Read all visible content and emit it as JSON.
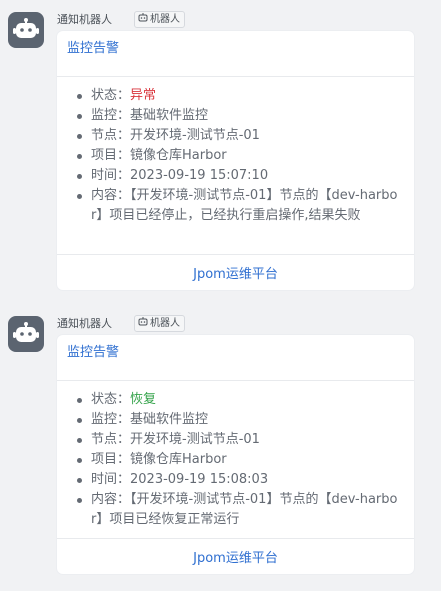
{
  "messages": [
    {
      "sender": "通知机器人",
      "bot_tag": "机器人",
      "card": {
        "title": "监控告警",
        "items": [
          {
            "label": "状态：",
            "value": "异常",
            "status_color": "#d9363e"
          },
          {
            "label": "监控：",
            "value": "基础软件监控"
          },
          {
            "label": "节点：",
            "value": "开发环境-测试节点-01"
          },
          {
            "label": "项目：",
            "value": "镜像仓库Harbor"
          },
          {
            "label": "时间：",
            "value": "2023-09-19 15:07:10"
          },
          {
            "label": "内容：",
            "value": "【开发环境-测试节点-01】节点的【dev-harbor】项目已经停止，已经执行重启操作,结果失败"
          }
        ],
        "footer_link": "Jpom运维平台"
      }
    },
    {
      "sender": "通知机器人",
      "bot_tag": "机器人",
      "card": {
        "title": "监控告警",
        "items": [
          {
            "label": "状态：",
            "value": "恢复",
            "status_color": "#34a34a"
          },
          {
            "label": "监控：",
            "value": "基础软件监控"
          },
          {
            "label": "节点：",
            "value": "开发环境-测试节点-01"
          },
          {
            "label": "项目：",
            "value": "镜像仓库Harbor"
          },
          {
            "label": "时间：",
            "value": "2023-09-19 15:08:03"
          },
          {
            "label": "内容：",
            "value": "【开发环境-测试节点-01】节点的【dev-harbor】项目已经恢复正常运行"
          }
        ],
        "footer_link": "Jpom运维平台"
      }
    }
  ]
}
